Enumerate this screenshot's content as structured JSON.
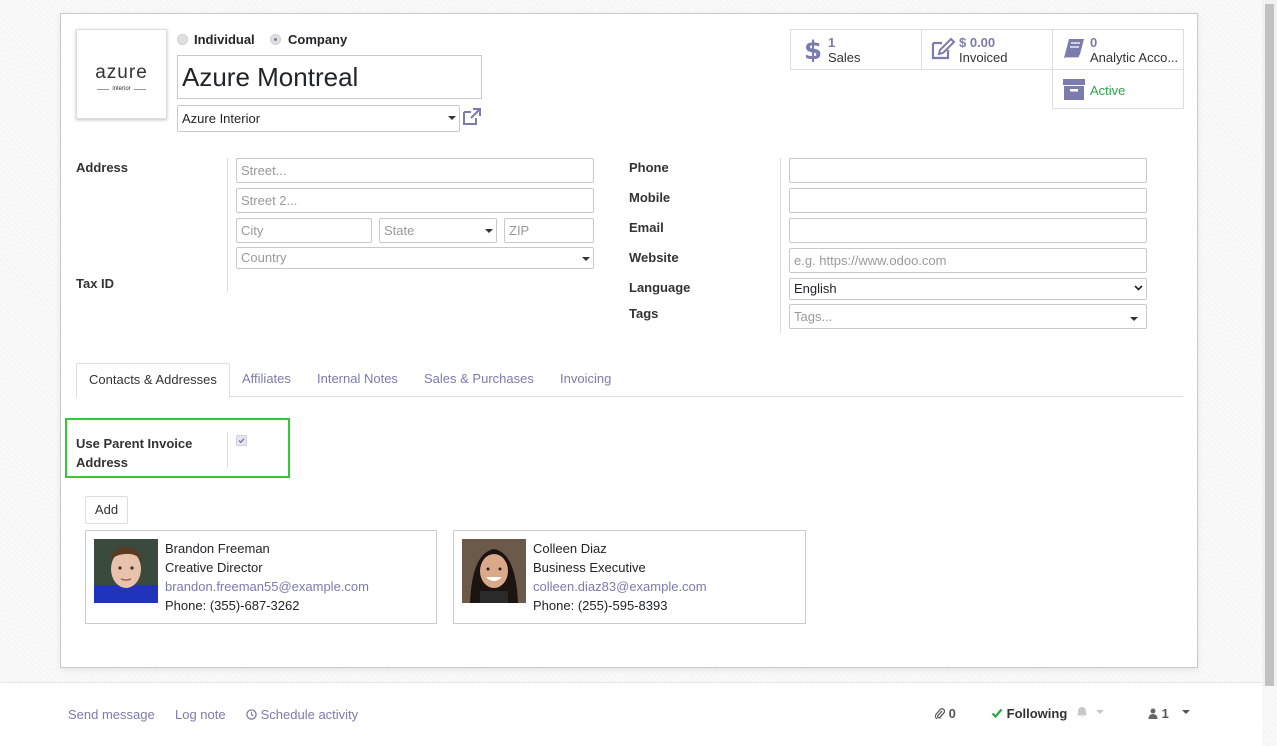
{
  "partner": {
    "type_options": [
      {
        "label": "Individual",
        "selected": false
      },
      {
        "label": "Company",
        "selected": true
      }
    ],
    "logo_text": "azure",
    "logo_subtext": "interior",
    "name": "Azure Montreal",
    "parent_company": "Azure Interior"
  },
  "smart_buttons": [
    {
      "icon": "dollar-icon",
      "number": "1",
      "label": "Sales"
    },
    {
      "icon": "pencil-square-icon",
      "number": "$ 0.00",
      "label": "Invoiced"
    },
    {
      "icon": "book-icon",
      "number": "0",
      "label": "Analytic Acco..."
    },
    {
      "icon": "archive-icon",
      "number": "",
      "label": "Active",
      "color": "#28a745"
    }
  ],
  "address": {
    "label": "Address",
    "street_placeholder": "Street...",
    "street2_placeholder": "Street 2...",
    "city_placeholder": "City",
    "state_placeholder": "State",
    "zip_placeholder": "ZIP",
    "country_placeholder": "Country"
  },
  "tax_id": {
    "label": "Tax ID"
  },
  "contact": {
    "phone_label": "Phone",
    "mobile_label": "Mobile",
    "email_label": "Email",
    "website_label": "Website",
    "website_placeholder": "e.g. https://www.odoo.com",
    "language_label": "Language",
    "language_value": "English",
    "tags_label": "Tags",
    "tags_placeholder": "Tags..."
  },
  "tabs": [
    {
      "label": "Contacts & Addresses",
      "active": true
    },
    {
      "label": "Affiliates",
      "active": false
    },
    {
      "label": "Internal Notes",
      "active": false
    },
    {
      "label": "Sales & Purchases",
      "active": false
    },
    {
      "label": "Invoicing",
      "active": false
    }
  ],
  "use_parent_invoice": {
    "label": "Use Parent Invoice Address",
    "checked": true
  },
  "add_button": "Add",
  "contacts": [
    {
      "name": "Brandon Freeman",
      "title": "Creative Director",
      "email": "brandon.freeman55@example.com",
      "phone": "Phone: (355)-687-3262"
    },
    {
      "name": "Colleen Diaz",
      "title": "Business Executive",
      "email": "colleen.diaz83@example.com",
      "phone": "Phone: (255)-595-8393"
    }
  ],
  "chatter": {
    "send_message": "Send message",
    "log_note": "Log note",
    "schedule_activity": "Schedule activity",
    "attachments_count": "0",
    "following_label": "Following",
    "followers_count": "1"
  },
  "colors": {
    "accent": "#7c7bad",
    "active_green": "#28a745",
    "highlight": "#34c934"
  }
}
